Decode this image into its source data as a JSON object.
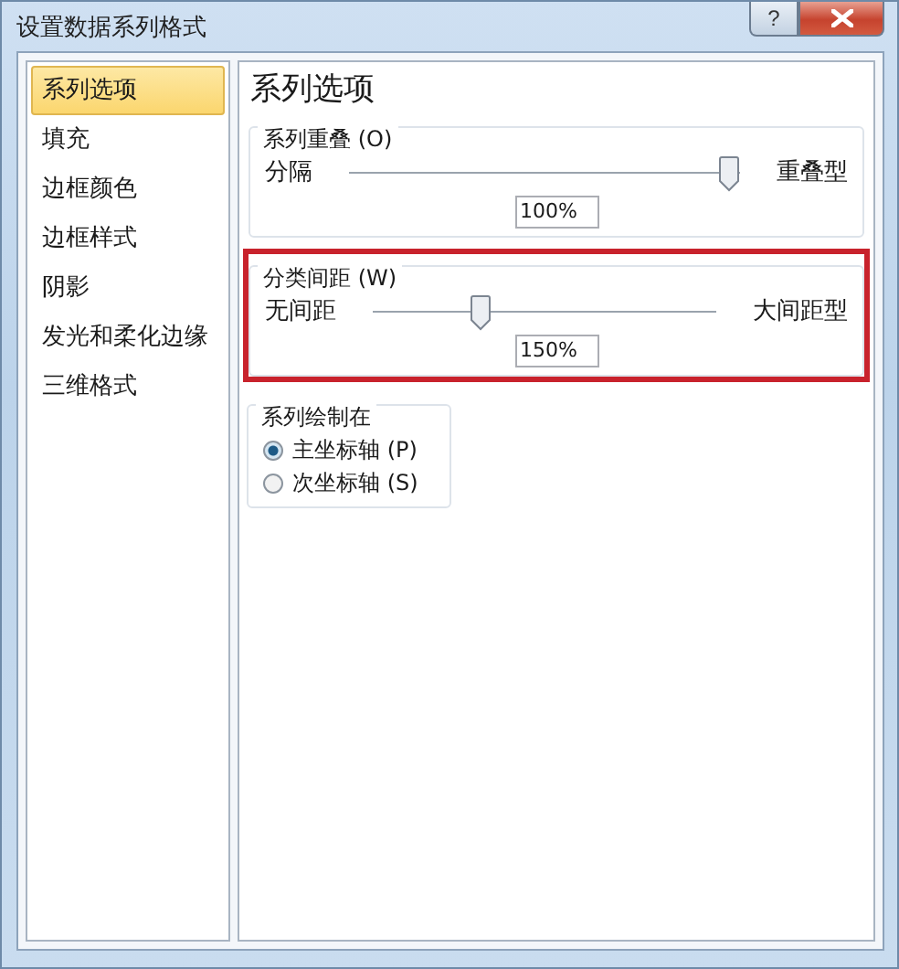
{
  "window": {
    "title": "设置数据系列格式",
    "buttons": [
      {
        "kind": "help",
        "label": "?"
      },
      {
        "kind": "close"
      }
    ]
  },
  "sidebar": {
    "items": [
      {
        "label": "系列选项",
        "selected": true
      },
      {
        "label": "填充",
        "selected": false
      },
      {
        "label": "边框颜色",
        "selected": false
      },
      {
        "label": "边框样式",
        "selected": false
      },
      {
        "label": "阴影",
        "selected": false
      },
      {
        "label": "发光和柔化边缘",
        "selected": false
      },
      {
        "label": "三维格式",
        "selected": false
      }
    ]
  },
  "panel": {
    "heading": "系列选项",
    "groups": [
      {
        "kind": "slider",
        "label": "系列重叠 (O)",
        "min_label": "分隔",
        "max_label": "重叠型",
        "level": 1,
        "value": "100%",
        "highlighted": false
      },
      {
        "kind": "slider",
        "label": "分类间距 (W)",
        "min_label": "无间距",
        "max_label": "大间距型",
        "level": 0.3,
        "value": "150%",
        "highlighted": true
      },
      {
        "kind": "radios",
        "label": "系列绘制在",
        "options": [
          {
            "label": "主坐标轴 (P)",
            "selected": true
          },
          {
            "label": "次坐标轴 (S)",
            "selected": false
          }
        ]
      }
    ]
  }
}
